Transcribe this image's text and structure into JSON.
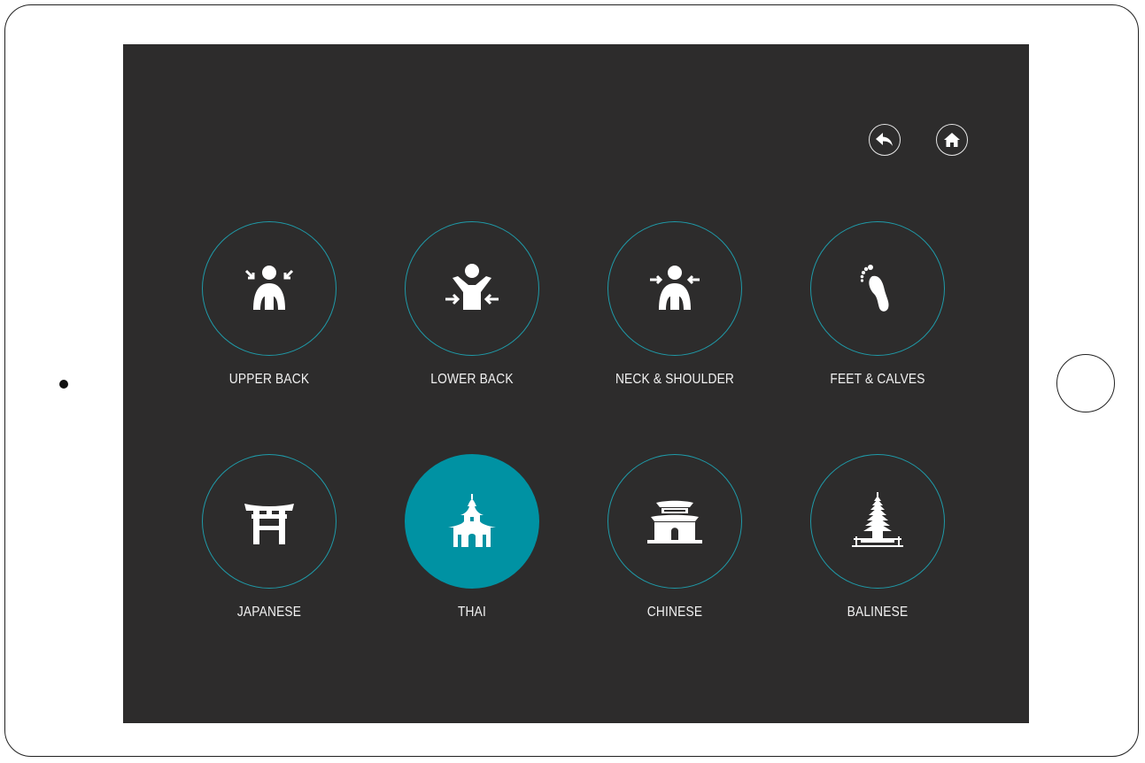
{
  "app": {
    "background_color": "#2d2c2c",
    "accent_color": "#0092a3",
    "ring_color": "#1f9aa8"
  },
  "header": {
    "back_icon": "back-arrow-icon",
    "home_icon": "home-icon"
  },
  "massage_areas": [
    {
      "label": "UPPER BACK",
      "icon": "upper-back-icon"
    },
    {
      "label": "LOWER BACK",
      "icon": "lower-back-icon"
    },
    {
      "label": "NECK & SHOULDER",
      "icon": "neck-shoulder-icon"
    },
    {
      "label": "FEET & CALVES",
      "icon": "feet-calves-icon"
    }
  ],
  "massage_styles": [
    {
      "label": "JAPANESE",
      "icon": "torii-gate-icon",
      "selected": false
    },
    {
      "label": "THAI",
      "icon": "thai-temple-icon",
      "selected": true
    },
    {
      "label": "CHINESE",
      "icon": "chinese-pavilion-icon",
      "selected": false
    },
    {
      "label": "BALINESE",
      "icon": "balinese-pagoda-icon",
      "selected": false
    }
  ]
}
